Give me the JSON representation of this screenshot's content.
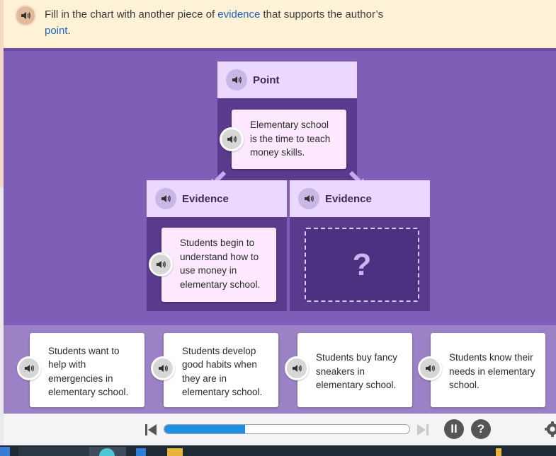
{
  "instruction": {
    "before": "Fill in the chart with another piece of ",
    "link1": "evidence",
    "middle": " that supports the author’s ",
    "link2": "point",
    "after": "."
  },
  "point": {
    "label": "Point",
    "text": "Elementary school is the time to teach money skills."
  },
  "evidence_left": {
    "label": "Evidence",
    "text": "Students begin to understand how to use money in elementary school."
  },
  "evidence_right": {
    "label": "Evidence",
    "placeholder": "?"
  },
  "answers": [
    {
      "text": "Students want to help with emergencies in elementary school."
    },
    {
      "text": "Students develop good habits when they are in elementary school."
    },
    {
      "text": "Students buy fancy sneakers in elementary school."
    },
    {
      "text": "Students know their needs in elementary school."
    }
  ],
  "controls": {
    "progress": 0.33,
    "pause_symbol": "II",
    "help_symbol": "?"
  },
  "colors": {
    "accent_purple": "#7e5eb6",
    "dark_purple": "#5a3a8c",
    "label_lavender": "#ead8ff",
    "link_blue": "#1f63c7",
    "progress_blue": "#1e8fe0"
  },
  "icons": {
    "audio": "speaker-icon",
    "rewind": "skip-back-icon",
    "forward": "skip-forward-icon",
    "settings": "gear-icon"
  }
}
